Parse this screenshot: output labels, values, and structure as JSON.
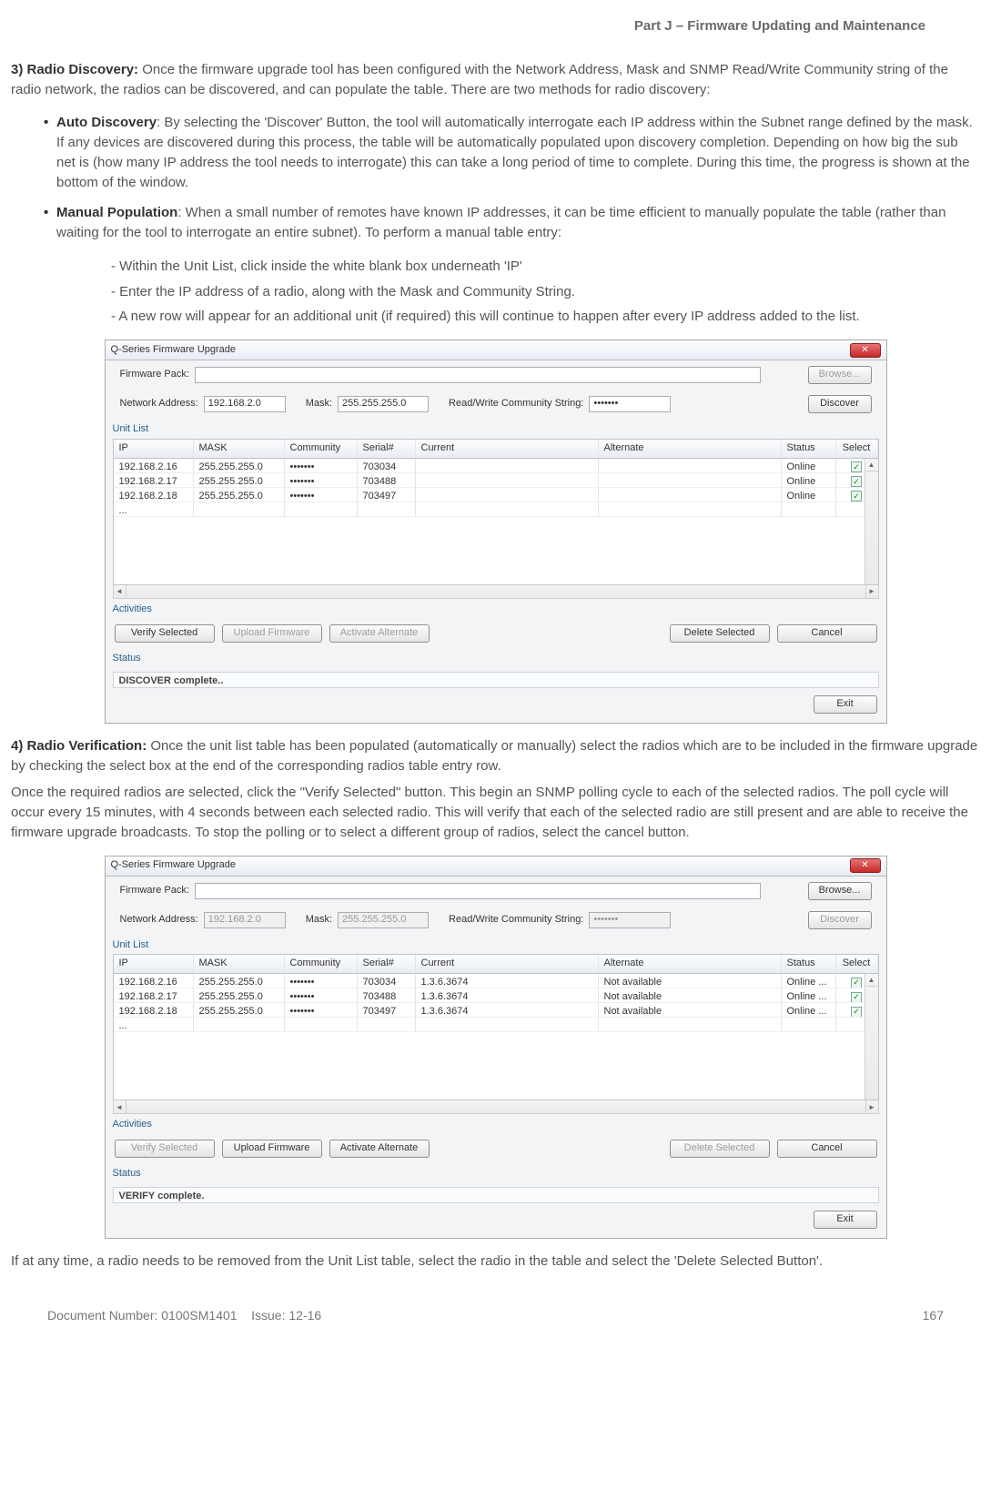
{
  "header": {
    "part_title": "Part J – Firmware Updating and Maintenance"
  },
  "sec3": {
    "heading": "3) Radio Discovery:",
    "intro": "Once the firmware upgrade tool has been configured with the Network Address, Mask and SNMP Read/Write Community string of the radio network, the radios can be discovered, and can populate the table. There are two methods for radio discovery:",
    "auto_title": "Auto Discovery",
    "auto_text": ": By selecting the 'Discover' Button, the tool will automatically interrogate each IP address within the Subnet range defined by the mask. If any devices are discovered during this process, the table will be automatically populated upon discovery completion. Depending on how big the sub net is (how many IP address the tool needs to interrogate) this can take a long period of time to complete. During this time, the progress is shown at the bottom of the window.",
    "manual_title": "Manual Population",
    "manual_text": ": When a small number of remotes have known IP addresses, it can be time efficient to manually populate the table (rather than waiting for the tool to interrogate an entire subnet). To perform a manual table entry:",
    "dash1": "- Within the Unit List, click inside the white blank box underneath 'IP'",
    "dash2": "- Enter the IP address of a radio, along with the Mask and Community String.",
    "dash3": "- A new row will appear for an additional unit (if required) this will continue to happen after every IP address added to the list."
  },
  "sec4": {
    "heading": "4) Radio Verification:",
    "p1": "Once the unit list table has been populated (automatically or manually) select the radios which are to be included in the firmware upgrade by checking the select box at the end of the corresponding radios table entry row.",
    "p2": "Once the required radios are selected, click the \"Verify Selected\" button. This begin an SNMP polling cycle to each of the selected radios. The poll cycle will occur every 15 minutes, with 4 seconds between each selected radio. This will verify that each of the selected radio are still present and are able to receive the firmware upgrade broadcasts. To stop the polling or to select a different group of radios, select the cancel button.",
    "p3": "If at any time, a radio needs to be removed from the Unit List table, select the radio in the table and select the 'Delete Selected Button'."
  },
  "app_common": {
    "title": "Q-Series Firmware Upgrade",
    "labels": {
      "firmware_pack": "Firmware Pack:",
      "network_address": "Network Address:",
      "mask": "Mask:",
      "rwcs": "Read/Write Community String:",
      "unit_list": "Unit List",
      "activities": "Activities",
      "status": "Status"
    },
    "buttons": {
      "browse": "Browse...",
      "discover": "Discover",
      "verify": "Verify Selected",
      "upload": "Upload Firmware",
      "activate": "Activate Alternate",
      "delete": "Delete Selected",
      "cancel": "Cancel",
      "exit": "Exit"
    },
    "columns": {
      "ip": "IP",
      "mask": "MASK",
      "community": "Community",
      "serial": "Serial#",
      "current": "Current",
      "alternate": "Alternate",
      "status": "Status",
      "select": "Select"
    },
    "fields": {
      "network_address": "192.168.2.0",
      "mask": "255.255.255.0",
      "community_dots": "•••••••"
    }
  },
  "app1": {
    "status_text": "DISCOVER complete..",
    "network_disabled": false,
    "browse_disabled": true,
    "discover_disabled": false,
    "btn_states": {
      "verify": true,
      "upload": false,
      "activate": false,
      "delete": true,
      "cancel": true
    },
    "rows": [
      {
        "ip": "192.168.2.16",
        "mask": "255.255.255.0",
        "community": "•••••••",
        "serial": "703034",
        "current": "",
        "alternate": "",
        "status": "Online",
        "select": true
      },
      {
        "ip": "192.168.2.17",
        "mask": "255.255.255.0",
        "community": "•••••••",
        "serial": "703488",
        "current": "",
        "alternate": "",
        "status": "Online",
        "select": true
      },
      {
        "ip": "192.168.2.18",
        "mask": "255.255.255.0",
        "community": "•••••••",
        "serial": "703497",
        "current": "",
        "alternate": "",
        "status": "Online",
        "select": true
      },
      {
        "ip": "...",
        "mask": "",
        "community": "",
        "serial": "",
        "current": "",
        "alternate": "",
        "status": "",
        "select": false
      }
    ]
  },
  "app2": {
    "status_text": "VERIFY complete.",
    "network_disabled": true,
    "browse_disabled": false,
    "discover_disabled": true,
    "btn_states": {
      "verify": false,
      "upload": true,
      "activate": true,
      "delete": false,
      "cancel": true
    },
    "rows": [
      {
        "ip": "192.168.2.16",
        "mask": "255.255.255.0",
        "community": "•••••••",
        "serial": "703034",
        "current": "1.3.6.3674",
        "alternate": "Not available",
        "status": "Online ...",
        "select": true
      },
      {
        "ip": "192.168.2.17",
        "mask": "255.255.255.0",
        "community": "•••••••",
        "serial": "703488",
        "current": "1.3.6.3674",
        "alternate": "Not available",
        "status": "Online ...",
        "select": true
      },
      {
        "ip": "192.168.2.18",
        "mask": "255.255.255.0",
        "community": "•••••••",
        "serial": "703497",
        "current": "1.3.6.3674",
        "alternate": "Not available",
        "status": "Online ...",
        "select": true
      },
      {
        "ip": "...",
        "mask": "",
        "community": "",
        "serial": "",
        "current": "",
        "alternate": "",
        "status": "",
        "select": false
      }
    ]
  },
  "footer": {
    "document_number": "Document Number: 0100SM1401",
    "issue": "Issue: 12-16",
    "page": "167"
  }
}
